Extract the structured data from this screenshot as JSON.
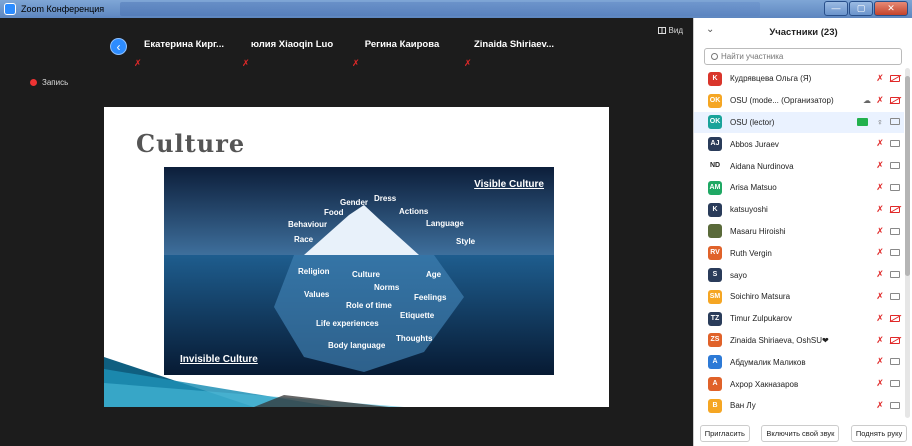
{
  "window": {
    "title": "Zoom Конференция",
    "buttons": [
      "—",
      "▢",
      "✕"
    ]
  },
  "video_strip": {
    "participants": [
      {
        "name": "Екатерина Кирг..."
      },
      {
        "name": "юлия Xiaoqin Luo"
      },
      {
        "name": "Регина Каирова"
      },
      {
        "name": "Zinaida Shiriaev..."
      }
    ],
    "view_label": "Вид",
    "recording_label": "Запись"
  },
  "slide": {
    "title": "Culture",
    "visible_label": "Visible Culture",
    "invisible_label": "Invisible Culture",
    "above_water": [
      "Dress",
      "Gender",
      "Food",
      "Actions",
      "Behaviour",
      "Language",
      "Race",
      "Style"
    ],
    "below_water": [
      "Religion",
      "Culture",
      "Age",
      "Norms",
      "Values",
      "Feelings",
      "Role of time",
      "Etiquette",
      "Life experiences",
      "Thoughts",
      "Body language"
    ]
  },
  "panel": {
    "title": "Участники (23)",
    "search_placeholder": "Найти участника",
    "participants": [
      {
        "initials": "K",
        "color": "#d9352b",
        "name": "Кудрявцева Ольга (Я)",
        "cam_off": true
      },
      {
        "initials": "OK",
        "color": "#f5a623",
        "name": "OSU (mode... (Организатор)",
        "cam_off": true,
        "cloud": true
      },
      {
        "initials": "OK",
        "color": "#1aa39a",
        "name": "OSU (lector)",
        "cam_off": false,
        "mic_on": true,
        "share": true
      },
      {
        "initials": "AJ",
        "color": "#2a3c5a",
        "name": "Abbos Juraev",
        "cam_off": false
      },
      {
        "initials": "ND",
        "color": "#ffffff",
        "text_color": "#222",
        "name": "Aidana Nurdinova",
        "cam_off": false
      },
      {
        "initials": "AM",
        "color": "#1fa864",
        "name": "Arisa Matsuo",
        "cam_off": false
      },
      {
        "initials": "K",
        "color": "#2a3c5a",
        "name": "katsuyoshi",
        "cam_off": true
      },
      {
        "initials": "",
        "color": "#5a6a3a",
        "name": "Masaru Hiroishi",
        "cam_off": false
      },
      {
        "initials": "RV",
        "color": "#e0622a",
        "name": "Ruth Vergin",
        "cam_off": false
      },
      {
        "initials": "S",
        "color": "#2a3c5a",
        "name": "sayo",
        "cam_off": false
      },
      {
        "initials": "SM",
        "color": "#f5a623",
        "name": "Soichiro Matsura",
        "cam_off": false
      },
      {
        "initials": "TZ",
        "color": "#2a3c5a",
        "name": "Timur Zulpukarov",
        "cam_off": true
      },
      {
        "initials": "ZS",
        "color": "#e0622a",
        "name": "Zinaida Shiriaeva, OshSU❤",
        "cam_off": true
      },
      {
        "initials": "A",
        "color": "#2d7ad6",
        "name": "Абдумалик Маликов",
        "cam_off": false
      },
      {
        "initials": "A",
        "color": "#e0622a",
        "name": "Ахрор Хакназаров",
        "cam_off": false
      },
      {
        "initials": "B",
        "color": "#f5a623",
        "name": "Ван Лу",
        "cam_off": false
      }
    ],
    "footer": {
      "invite": "Пригласить",
      "unmute": "Включить свой звук",
      "raise": "Поднять руку"
    }
  }
}
